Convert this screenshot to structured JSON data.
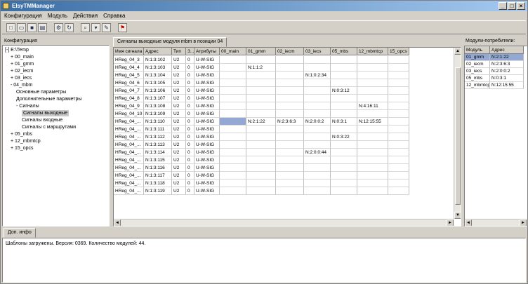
{
  "window": {
    "title": "ElsyTMManager",
    "min": "_",
    "max": "□",
    "close": "×"
  },
  "menu": [
    "Конфигурация",
    "Модуль",
    "Действия",
    "Справка"
  ],
  "toolbar": [
    "new-icon",
    "open-icon",
    "save-icon",
    "save-all-icon",
    "settings-icon",
    "refresh-icon",
    "find-icon",
    "filter-icon",
    "edit-icon",
    "flag-icon"
  ],
  "left": {
    "title": "Конфигурация",
    "tree": [
      {
        "label": "[-] E:\\Temp",
        "level": 0
      },
      {
        "label": "+ 00_main",
        "level": 1
      },
      {
        "label": "+ 01_gmm",
        "level": 1
      },
      {
        "label": "+ 02_iecm",
        "level": 1
      },
      {
        "label": "+ 03_iecs",
        "level": 1
      },
      {
        "label": "- 04_mbm",
        "level": 1
      },
      {
        "label": "Основные параметры",
        "level": 2
      },
      {
        "label": "Дополнительные параметры",
        "level": 2
      },
      {
        "label": "- Сигналы",
        "level": 2
      },
      {
        "label": "Сигналы выходные",
        "level": 3,
        "selected": true
      },
      {
        "label": "Сигналы входные",
        "level": 3
      },
      {
        "label": "Сигналы с маршрутами",
        "level": 3
      },
      {
        "label": "+ 05_mbs",
        "level": 1
      },
      {
        "label": "+ 12_mbmtcp",
        "level": 1
      },
      {
        "label": "+ 15_opcs",
        "level": 1
      }
    ]
  },
  "main": {
    "tab": "Сигналы выходные модуля mbm в позиции 04",
    "columns": [
      "Имя сигнала",
      "Адрес",
      "Тип",
      "З...",
      "Атрибуты",
      "00_main",
      "01_gmm",
      "02_iecm",
      "03_iecs",
      "05_mbs",
      "12_mbmtcp",
      "15_opcs"
    ],
    "rows": [
      [
        "HReg_04_3",
        "N:1:3:102",
        "U2",
        "0",
        "U-W-SIG",
        "",
        "",
        "",
        "",
        "",
        "",
        ""
      ],
      [
        "HReg_04_4",
        "N:1:3:103",
        "U2",
        "0",
        "U-W-SIG",
        "",
        "N:1:1:2",
        "",
        "",
        "",
        "",
        ""
      ],
      [
        "HReg_04_5",
        "N:1:3:104",
        "U2",
        "0",
        "U-W-SIG",
        "",
        "",
        "",
        "N:1:0:2:34",
        "",
        "",
        ""
      ],
      [
        "HReg_04_6",
        "N:1:3:105",
        "U2",
        "0",
        "U-W-SIG",
        "",
        "",
        "",
        "",
        "",
        "",
        ""
      ],
      [
        "HReg_04_7",
        "N:1:3:106",
        "U2",
        "0",
        "U-W-SIG",
        "",
        "",
        "",
        "",
        "N:0:3:12",
        "",
        ""
      ],
      [
        "HReg_04_8",
        "N:1:3:107",
        "U2",
        "0",
        "U-W-SIG",
        "",
        "",
        "",
        "",
        "",
        "",
        ""
      ],
      [
        "HReg_04_9",
        "N:1:3:108",
        "U2",
        "0",
        "U-W-SIG",
        "",
        "",
        "",
        "",
        "",
        "N:4:16:11",
        ""
      ],
      [
        "HReg_04_10",
        "N:1:3:109",
        "U2",
        "0",
        "U-W-SIG",
        "",
        "",
        "",
        "",
        "",
        "",
        ""
      ],
      [
        "HReg_04_...",
        "N:1:3:110",
        "U2",
        "0",
        "U-W-SIG",
        "",
        "N:2:1:22",
        "N:2:3:6:3",
        "N:2:0:0:2",
        "N:0:3:1",
        "N:12:15:55",
        ""
      ],
      [
        "HReg_04_...",
        "N:1:3:111",
        "U2",
        "0",
        "U-W-SIG",
        "",
        "",
        "",
        "",
        "",
        "",
        ""
      ],
      [
        "HReg_04_...",
        "N:1:3:112",
        "U2",
        "0",
        "U-W-SIG",
        "",
        "",
        "",
        "",
        "N:0:3:22",
        "",
        ""
      ],
      [
        "HReg_04_...",
        "N:1:3:113",
        "U2",
        "0",
        "U-W-SIG",
        "",
        "",
        "",
        "",
        "",
        "",
        ""
      ],
      [
        "HReg_04_...",
        "N:1:3:114",
        "U2",
        "0",
        "U-W-SIG",
        "",
        "",
        "",
        "N:2:0:0:44",
        "",
        "",
        ""
      ],
      [
        "HReg_04_...",
        "N:1:3:115",
        "U2",
        "0",
        "U-W-SIG",
        "",
        "",
        "",
        "",
        "",
        "",
        ""
      ],
      [
        "HReg_04_...",
        "N:1:3:116",
        "U2",
        "0",
        "U-W-SIG",
        "",
        "",
        "",
        "",
        "",
        "",
        ""
      ],
      [
        "HReg_04_...",
        "N:1:3:117",
        "U2",
        "0",
        "U-W-SIG",
        "",
        "",
        "",
        "",
        "",
        "",
        ""
      ],
      [
        "HReg_04_...",
        "N:1:3:118",
        "U2",
        "0",
        "U-W-SIG",
        "",
        "",
        "",
        "",
        "",
        "",
        ""
      ],
      [
        "HReg_04_...",
        "N:1:3:119",
        "U2",
        "0",
        "U-W-SIG",
        "",
        "",
        "",
        "",
        "",
        "",
        ""
      ]
    ],
    "scroll_up": "▲",
    "scroll_down": "▼",
    "scroll_left": "◄",
    "scroll_right": "►"
  },
  "right": {
    "title": "Модули-потребители:",
    "columns": [
      "Модуль",
      "Адрес"
    ],
    "rows": [
      [
        "01_gmm",
        "N:2:1:22"
      ],
      [
        "02_iecm",
        "N:2:3:6:3"
      ],
      [
        "03_iecs",
        "N:2:0:0:2"
      ],
      [
        "05_mbs",
        "N:0:3:1"
      ],
      [
        "12_mbmtcp",
        "N:12:15:55"
      ]
    ],
    "scroll_left": "◄",
    "scroll_right": "►"
  },
  "bottom": {
    "tab": "Доп. инфо",
    "log": "Шаблоны загружены. Версия: 0369. Количество модулей: 44."
  },
  "colors": {
    "selection": "#93a8d3",
    "title_start": "#3a6ea5",
    "title_end": "#a6caf0",
    "face": "#d4d0c8"
  }
}
